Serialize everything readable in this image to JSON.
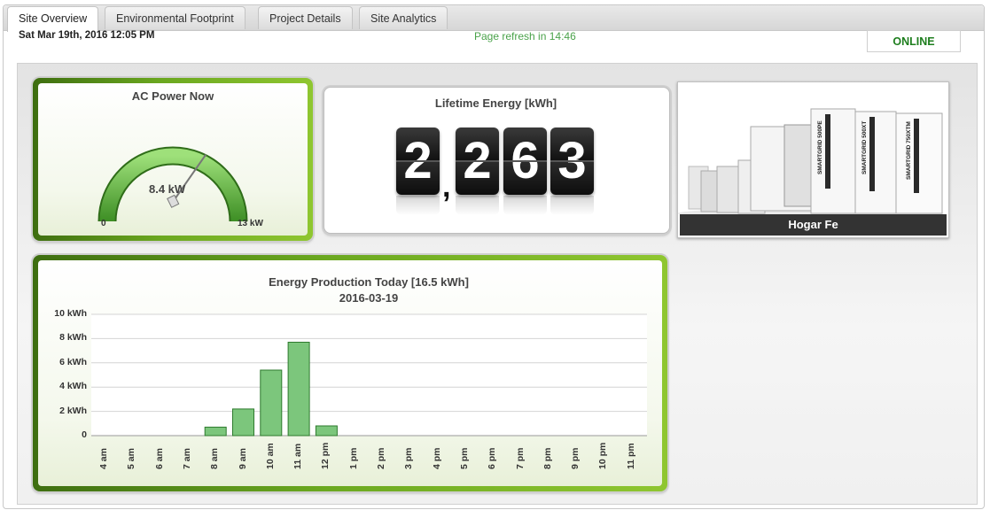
{
  "tabs": [
    {
      "label": "Site Overview",
      "active": true
    },
    {
      "label": "Environmental Footprint",
      "active": false
    },
    {
      "label": "Project Details",
      "active": false
    },
    {
      "label": "Site Analytics",
      "active": false
    }
  ],
  "header": {
    "datetime": "Sat Mar 19th, 2016 12:05 PM",
    "refresh": "Page refresh in 14:46",
    "status": "ONLINE"
  },
  "gauge": {
    "title": "AC Power Now",
    "value_label": "8.4 kW",
    "value": 8.4,
    "min_label": "0",
    "max_label": "13 kW",
    "min": 0,
    "max": 13
  },
  "lifetime": {
    "title": "Lifetime Energy [kWh]",
    "digits": [
      "2",
      "2",
      "6",
      "3"
    ],
    "separator": ","
  },
  "site_photo": {
    "label": "Hogar Fe",
    "cabinet_labels": [
      "SMARTGRID 500PE",
      "SMARTGRID 500XT",
      "SMARTGRID 750XTM"
    ]
  },
  "colors": {
    "accent_green": "#6aa71f",
    "status_green": "#1e7e1e",
    "refresh_green": "#4aa24a",
    "bar_fill": "#7cc67c"
  },
  "chart_data": {
    "type": "bar",
    "title": "Energy Production Today [16.5 kWh]",
    "subtitle": "2016-03-19",
    "categories": [
      "4 am",
      "5 am",
      "6 am",
      "7 am",
      "8 am",
      "9 am",
      "10 am",
      "11 am",
      "12 pm",
      "1 pm",
      "2 pm",
      "3 pm",
      "4 pm",
      "5 pm",
      "6 pm",
      "7 pm",
      "8 pm",
      "9 pm",
      "10 pm",
      "11 pm"
    ],
    "values": [
      0,
      0,
      0,
      0,
      0.7,
      2.2,
      5.4,
      7.7,
      0.8,
      0,
      0,
      0,
      0,
      0,
      0,
      0,
      0,
      0,
      0,
      0
    ],
    "ylim": [
      0,
      10
    ],
    "yticks": [
      0,
      2,
      4,
      6,
      8,
      10
    ],
    "ytick_labels": [
      "0",
      "2 kWh",
      "4 kWh",
      "6 kWh",
      "8 kWh",
      "10 kWh"
    ],
    "grid": true,
    "legend": "none"
  }
}
